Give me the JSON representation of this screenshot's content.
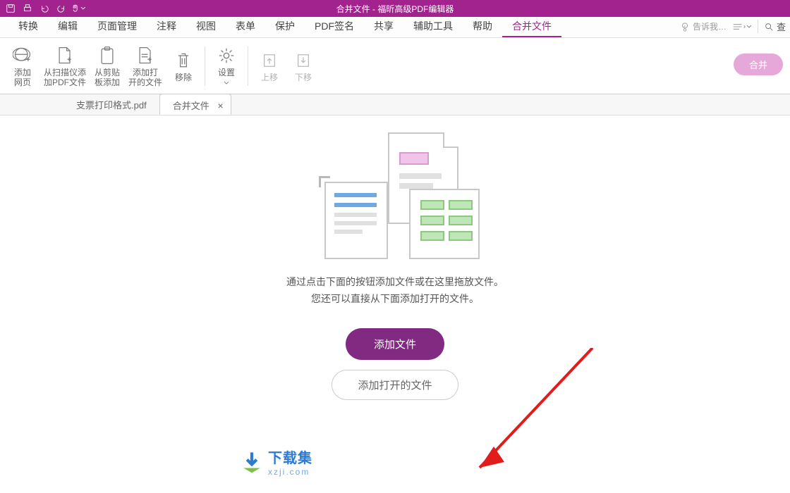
{
  "titlebar": {
    "title": "合并文件 - 福昕高级PDF编辑器"
  },
  "ribbon_tabs": {
    "items": [
      "转换",
      "编辑",
      "页面管理",
      "注释",
      "视图",
      "表单",
      "保护",
      "PDF签名",
      "共享",
      "辅助工具",
      "帮助",
      "合并文件"
    ],
    "active_index": 11
  },
  "search": {
    "placeholder": "告诉我…"
  },
  "find_label": "查",
  "ribbon_cmds": {
    "items": [
      {
        "label": "添加\n网页",
        "icon": "globe-plus-icon"
      },
      {
        "label": "从扫描仪添\n加PDF文件",
        "icon": "file-plus-icon"
      },
      {
        "label": "从剪贴\n板添加",
        "icon": "clipboard-icon"
      },
      {
        "label": "添加打\n开的文件",
        "icon": "file-open-plus-icon"
      },
      {
        "label": "移除",
        "icon": "trash-icon"
      }
    ],
    "settings": {
      "label": "设置",
      "icon": "gear-icon"
    },
    "up": {
      "label": "上移",
      "icon": "arrow-up-icon"
    },
    "down": {
      "label": "下移",
      "icon": "arrow-down-icon"
    },
    "merge_pill": "合并"
  },
  "doc_tabs": {
    "items": [
      {
        "label": "支票打印格式.pdf",
        "active": false
      },
      {
        "label": "合并文件",
        "active": true
      }
    ]
  },
  "empty_state": {
    "line1": "通过点击下面的按钮添加文件或在这里拖放文件。",
    "line2": "您还可以直接从下面添加打开的文件。",
    "btn_primary": "添加文件",
    "btn_outline": "添加打开的文件"
  },
  "watermark": {
    "text1": "下载集",
    "text2": "xzji.com"
  }
}
